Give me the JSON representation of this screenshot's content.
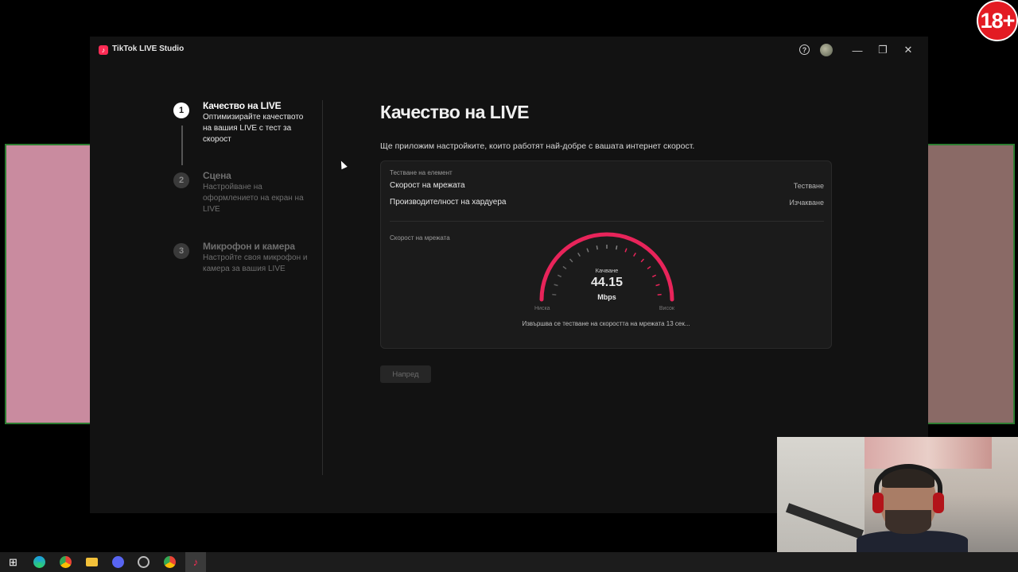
{
  "window": {
    "title": "TikTok LIVE Studio",
    "logo_icon": "tiktok-logo-icon",
    "controls": {
      "help_icon": "?",
      "minimize_icon": "—",
      "restore_icon": "❐",
      "close_icon": "✕"
    }
  },
  "steps": [
    {
      "number": "1",
      "title": "Качество на LIVE",
      "description": "Оптимизирайте качеството на вашия LIVE с тест за скорост",
      "state": "active"
    },
    {
      "number": "2",
      "title": "Сцена",
      "description": "Настройване на оформлението на екран на LIVE",
      "state": "inactive"
    },
    {
      "number": "3",
      "title": "Микрофон и камера",
      "description": "Настройте своя микрофон и камера за вашия LIVE",
      "state": "inactive"
    }
  ],
  "main": {
    "title": "Качество на LIVE",
    "subtitle": "Ще приложим настройките, които работят най-добре с вашата интернет скорост.",
    "card": {
      "items_label": "Тестване на елемент",
      "items": [
        {
          "name": "Скорост на мрежата",
          "status": "Тестване"
        },
        {
          "name": "Производителност на хардуера",
          "status": "Изчакване"
        }
      ],
      "gauge_section_label": "Скорост на мрежата",
      "gauge": {
        "caption": "Качване",
        "value": "44.15",
        "unit": "Mbps",
        "low_label": "Ниска",
        "high_label": "Висок",
        "progress_fraction": 1.0,
        "accent_color": "#e8245a"
      },
      "status_text": "Извършва се тестване на скоростта на мрежата 13 сек..."
    },
    "next_button": "Напред"
  },
  "badge": {
    "text": "18+",
    "color": "#e31b23"
  },
  "taskbar": {
    "icons": [
      "windows-start-icon",
      "edge-icon",
      "chrome-icon",
      "file-explorer-icon",
      "discord-icon",
      "app-icon",
      "chrome-icon",
      "tiktok-live-studio-icon"
    ]
  }
}
